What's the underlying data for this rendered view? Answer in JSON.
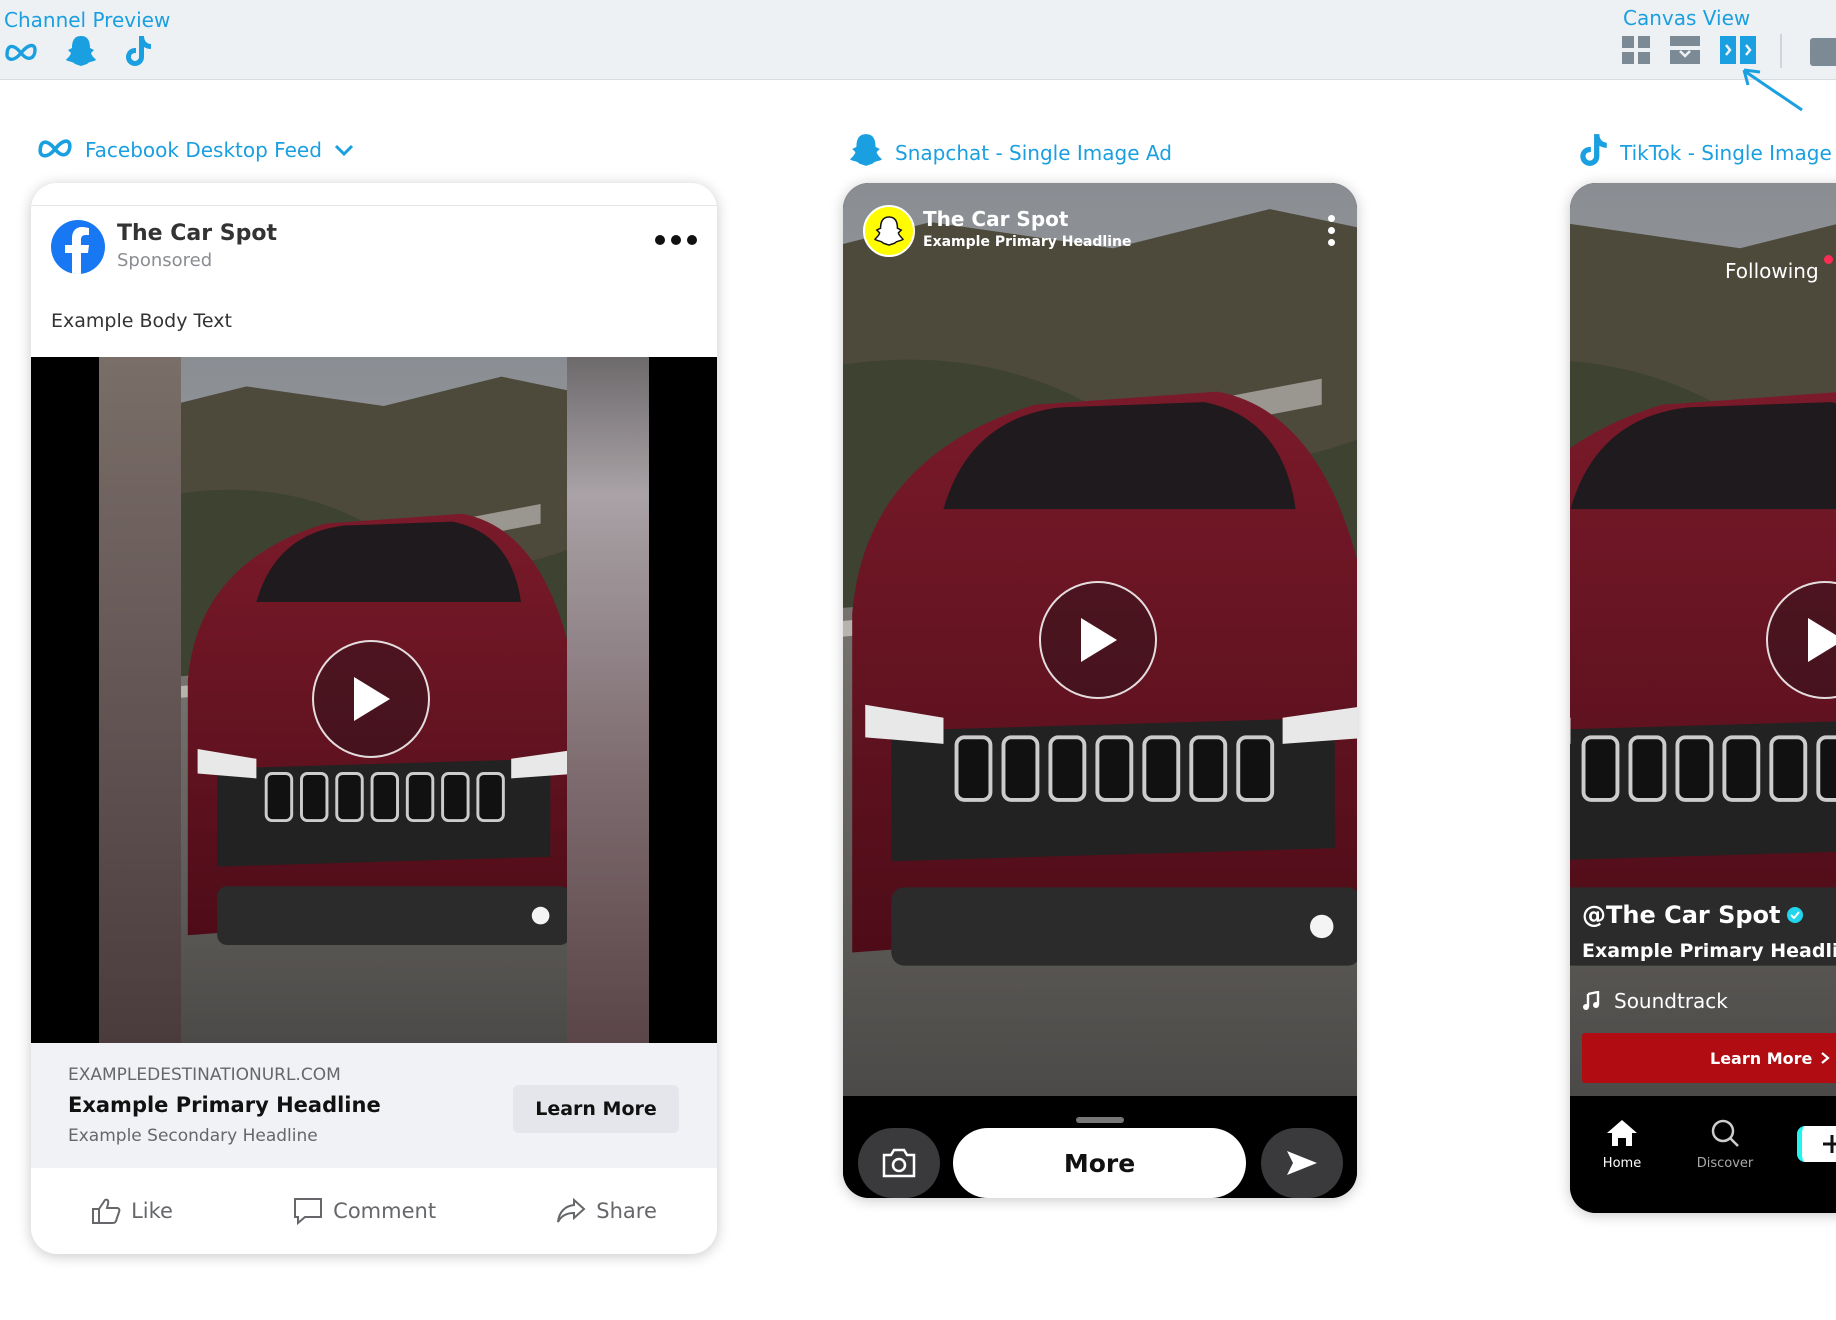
{
  "toolbar": {
    "channel_preview_label": "Channel Preview",
    "canvas_view_label": "Canvas View",
    "channel_icons": [
      "meta-icon",
      "snapchat-icon",
      "tiktok-icon"
    ],
    "canvas_icons": [
      "grid-view-icon",
      "stack-view-icon",
      "side-by-side-view-icon"
    ],
    "accent_color": "#1a9fe0"
  },
  "facebook": {
    "channel_label": "Facebook Desktop Feed",
    "page_name": "The Car Spot",
    "sponsored": "Sponsored",
    "body_text": "Example Body Text",
    "url": "EXAMPLEDESTINATIONURL.COM",
    "headline": "Example Primary Headline",
    "secondary_headline": "Example Secondary Headline",
    "cta": "Learn More",
    "actions": {
      "like": "Like",
      "comment": "Comment",
      "share": "Share"
    }
  },
  "snapchat": {
    "channel_label": "Snapchat - Single Image Ad",
    "name": "The Car Spot",
    "headline": "Example Primary Headline",
    "cta": "More"
  },
  "tiktok": {
    "channel_label": "TikTok - Single Image Ac",
    "following": "Following",
    "handle": "@The Car Spot",
    "headline": "Example Primary Headline",
    "sound": "Soundtrack",
    "cta": "Learn More",
    "nav": {
      "home": "Home",
      "discover": "Discover"
    }
  }
}
